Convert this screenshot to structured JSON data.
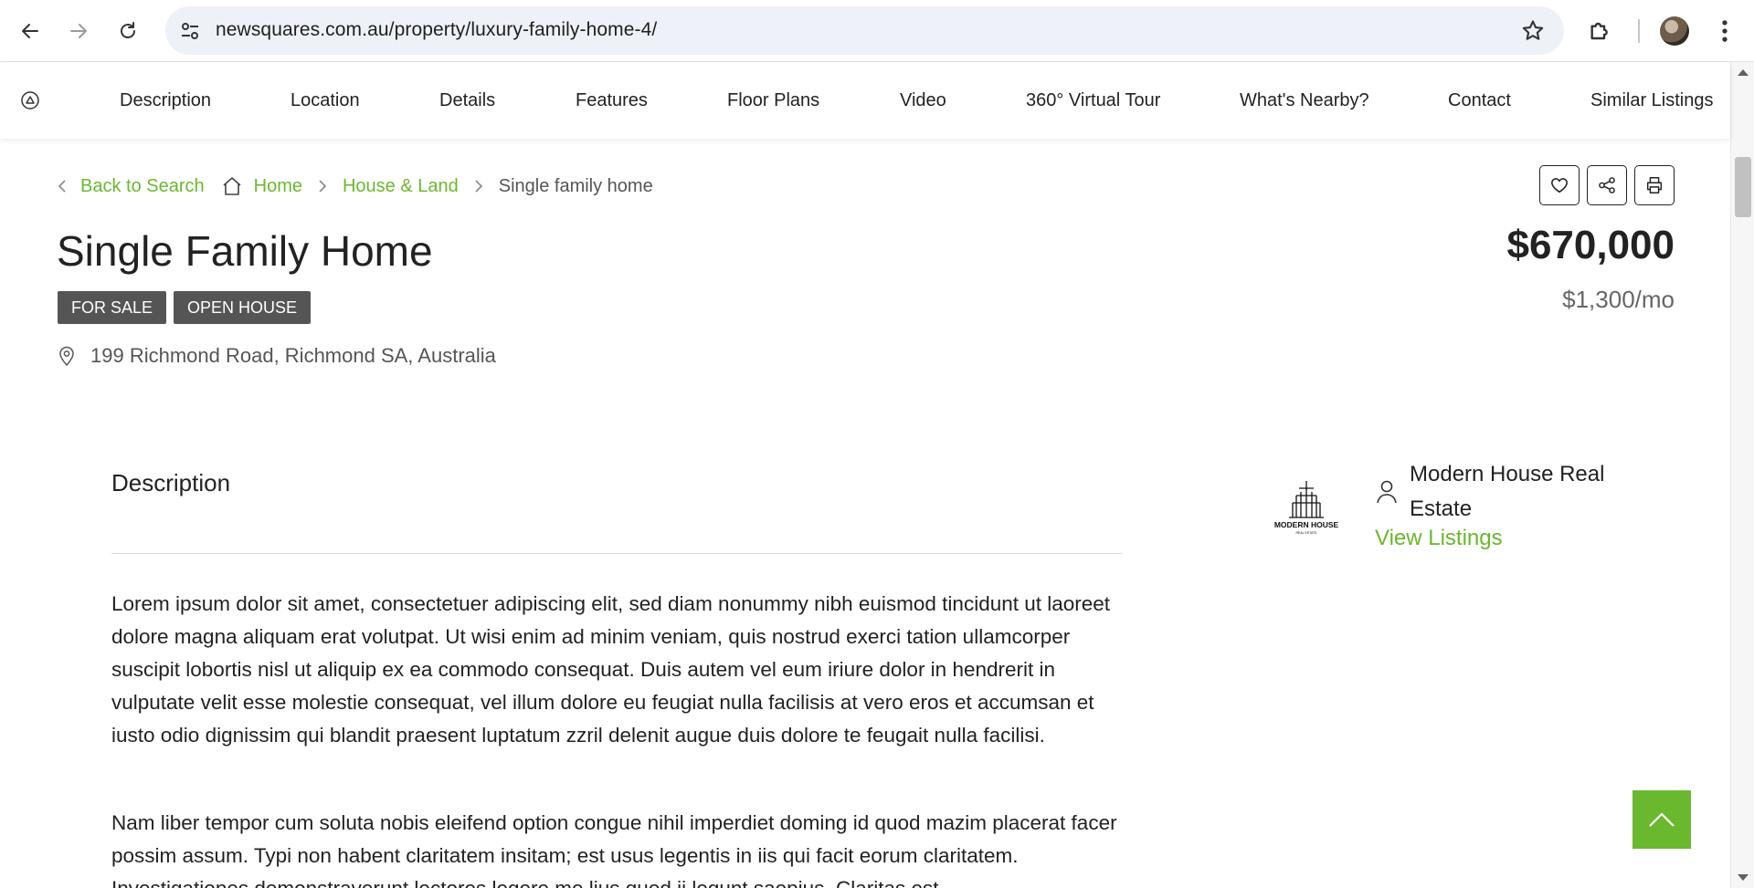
{
  "browser": {
    "url": "newsquares.com.au/property/luxury-family-home-4/"
  },
  "section_nav": {
    "items": [
      "Description",
      "Location",
      "Details",
      "Features",
      "Floor Plans",
      "Video",
      "360° Virtual Tour",
      "What's Nearby?",
      "Contact",
      "Similar Listings"
    ]
  },
  "breadcrumb": {
    "back": "Back to Search",
    "home": "Home",
    "category": "House & Land",
    "current": "Single family home"
  },
  "listing": {
    "title": "Single Family Home",
    "price": "$670,000",
    "price_monthly": "$1,300/mo",
    "badges": [
      "FOR SALE",
      "OPEN HOUSE"
    ],
    "address": "199 Richmond Road, Richmond SA, Australia"
  },
  "description": {
    "heading": "Description",
    "paragraphs": [
      "Lorem ipsum dolor sit amet, consectetuer adipiscing elit, sed diam nonummy nibh euismod tincidunt ut laoreet dolore magna aliquam erat volutpat. Ut wisi enim ad minim veniam, quis nostrud exerci tation ullamcorper suscipit lobortis nisl ut aliquip ex ea commodo consequat. Duis autem vel eum iriure dolor in hendrerit in vulputate velit esse molestie consequat, vel illum dolore eu feugiat nulla facilisis at vero eros et accumsan et iusto odio dignissim qui blandit praesent luptatum zzril delenit augue duis dolore te feugait nulla facilisi.",
      "Nam liber tempor cum soluta nobis eleifend option congue nihil imperdiet doming id quod mazim placerat facer possim assum. Typi non habent claritatem insitam; est usus legentis in iis qui facit eorum claritatem. Investigationes demonstraverunt lectores legere me lius quod ii legunt saepius. Claritas est"
    ]
  },
  "agent": {
    "logo_text": "MODERN HOUSE",
    "logo_subtext": "REAL ESTATE",
    "name": "Modern House Real Estate",
    "link": "View Listings"
  },
  "colors": {
    "accent": "#6ab82e",
    "badge_bg": "#555555"
  }
}
